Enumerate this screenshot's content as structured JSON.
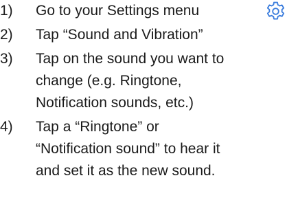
{
  "steps": [
    {
      "number": "1)",
      "text": "Go to your Settings menu"
    },
    {
      "number": "2)",
      "text": "Tap “Sound and Vibration”"
    },
    {
      "number": "3)",
      "text": "Tap on the sound you want to\nchange (e.g. Ringtone,\nNotification sounds, etc.)"
    },
    {
      "number": "4)",
      "text": "Tap a “Ringtone” or\n“Notification sound” to hear it\nand set it as the new sound."
    }
  ],
  "icon": {
    "name": "gear-icon",
    "color": "#3b7ddd"
  }
}
